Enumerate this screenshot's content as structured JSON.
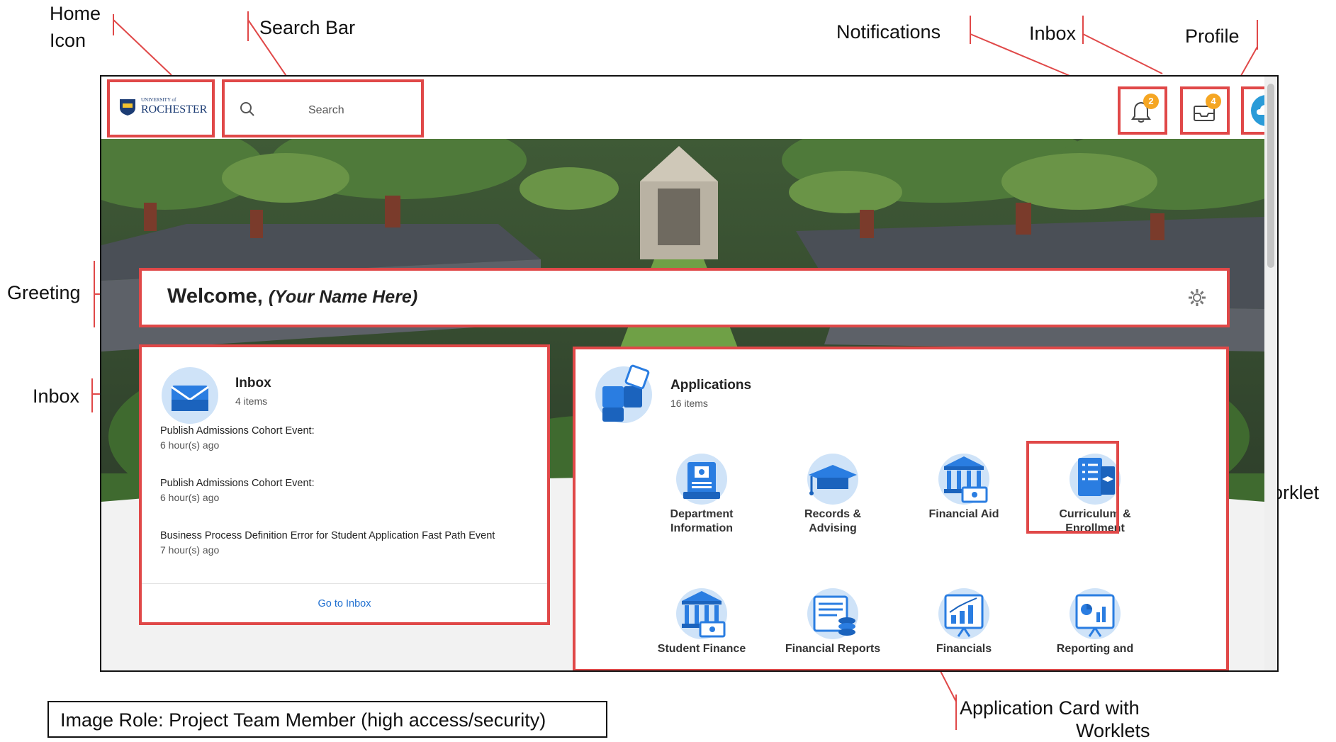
{
  "callouts": {
    "home_icon_line1": "Home",
    "home_icon_line2": "Icon",
    "search_bar": "Search Bar",
    "notifications": "Notifications",
    "inbox_top": "Inbox",
    "profile": "Profile",
    "greeting": "Greeting",
    "inbox_left": "Inbox",
    "worklet": "Worklet",
    "app_card_line1": "Application Card with",
    "app_card_line2": "Worklets"
  },
  "role_note": "Image Role: Project Team Member (high access/security)",
  "header": {
    "logo_small": "UNIVERSITY of",
    "logo_main": "ROCHESTER",
    "search_placeholder": "Search",
    "notification_count": "2",
    "inbox_count": "4"
  },
  "welcome": {
    "prefix": "Welcome,",
    "name": "(Your Name Here)"
  },
  "inbox": {
    "title": "Inbox",
    "count": "4 items",
    "items": [
      {
        "title": "Publish Admissions Cohort Event:",
        "time": "6 hour(s) ago"
      },
      {
        "title": "Publish Admissions Cohort Event:",
        "time": "6 hour(s) ago"
      },
      {
        "title": "Business Process Definition Error for Student Application Fast Path Event",
        "time": "7 hour(s) ago"
      }
    ],
    "link": "Go to Inbox"
  },
  "applications": {
    "title": "Applications",
    "count": "16 items",
    "apps": [
      {
        "line1": "Department",
        "line2": "Information",
        "icon": "department-info-icon"
      },
      {
        "line1": "Records &",
        "line2": "Advising",
        "icon": "graduation-cap-icon"
      },
      {
        "line1": "Financial Aid",
        "line2": "",
        "icon": "bank-money-icon"
      },
      {
        "line1": "Curriculum &",
        "line2": "Enrollment",
        "icon": "curriculum-book-icon"
      },
      {
        "line1": "Student Finance",
        "line2": "",
        "icon": "bank-money-icon"
      },
      {
        "line1": "Financial Reports",
        "line2": "",
        "icon": "report-coins-icon"
      },
      {
        "line1": "Financials",
        "line2": "",
        "icon": "growth-chart-icon"
      },
      {
        "line1": "Reporting and",
        "line2": "",
        "icon": "pie-bar-chart-icon"
      }
    ]
  },
  "colors": {
    "annotation_red": "#e04848",
    "icon_blue": "#2a7de1",
    "icon_light": "#cfe3f8",
    "badge": "#f5a623",
    "link_blue": "#1f6fd0"
  }
}
